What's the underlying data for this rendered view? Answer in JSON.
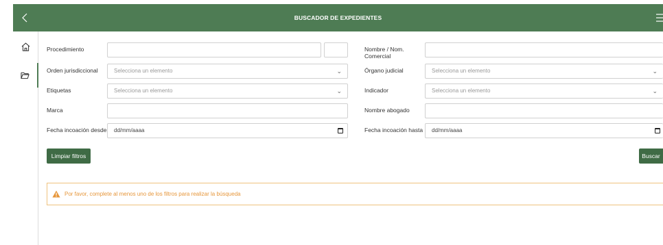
{
  "header": {
    "title": "BUSCADOR DE EXPEDIENTES",
    "bg_color": "#4e7c54"
  },
  "sidebar": {
    "items": [
      {
        "icon": "home-icon"
      },
      {
        "icon": "folder-icon"
      }
    ]
  },
  "form": {
    "procedimiento_label": "Procedimiento",
    "procedimiento_value": "",
    "nombre_comercial_label": "Nombre / Nom. Comercial",
    "nombre_comercial_value": "",
    "orden_label": "Orden jurisdiccional",
    "orden_placeholder": "Selecciona un elemento",
    "organo_label": "Órgano judicial",
    "organo_placeholder": "Selecciona un elemento",
    "etiquetas_label": "Etiquetas",
    "etiquetas_placeholder": "Selecciona un elemento",
    "indicador_label": "Indicador",
    "indicador_placeholder": "Selecciona un elemento",
    "marca_label": "Marca",
    "marca_value": "",
    "abogado_label": "Nombre abogado",
    "abogado_value": "",
    "fecha_desde_label": "Fecha incoación desde",
    "fecha_desde_placeholder": "dd/mm/aaaa",
    "fecha_hasta_label": "Fecha incoación hasta",
    "fecha_hasta_placeholder": "dd/mm/aaaa"
  },
  "buttons": {
    "clear_label": "Limpiar filtros",
    "search_label": "Buscar"
  },
  "alert": {
    "text": "Por favor, complete al menos uno de los filtros para realizar la búsqueda",
    "color": "#e6963a"
  }
}
